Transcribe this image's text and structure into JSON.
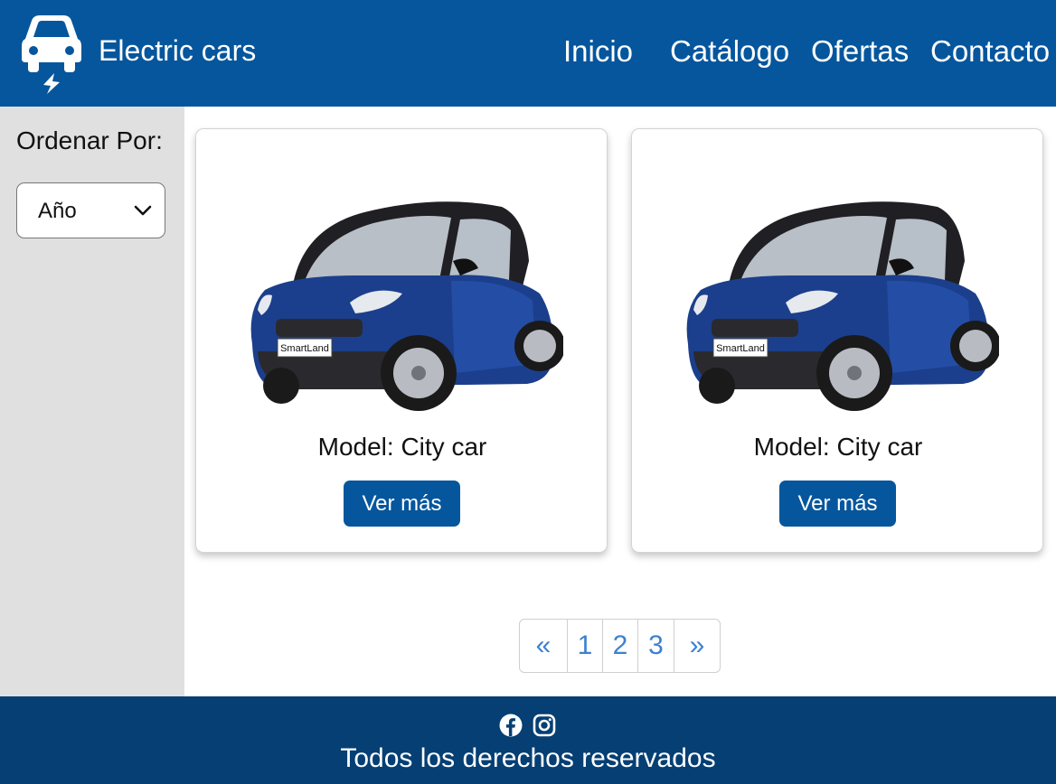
{
  "header": {
    "brand": "Electric cars",
    "nav": [
      "Inicio",
      "Catálogo",
      "Ofertas",
      "Contacto"
    ]
  },
  "sidebar": {
    "sort_label": "Ordenar Por:",
    "sort_value": "Año"
  },
  "cards": [
    {
      "title": "Model: City car",
      "button": "Ver más",
      "plate": "SmartLand"
    },
    {
      "title": "Model: City car",
      "button": "Ver más",
      "plate": "SmartLand"
    }
  ],
  "pagination": {
    "prev": "«",
    "pages": [
      "1",
      "2",
      "3"
    ],
    "next": "»"
  },
  "footer": {
    "icons": [
      "facebook-icon",
      "instagram-icon"
    ],
    "copyright": "Todos los derechos reservados"
  },
  "colors": {
    "header_bg": "#05569d",
    "footer_bg": "#053f73",
    "sidebar_bg": "#e0e0e0",
    "button_bg": "#05569d",
    "pagination_text": "#3b82d0"
  }
}
